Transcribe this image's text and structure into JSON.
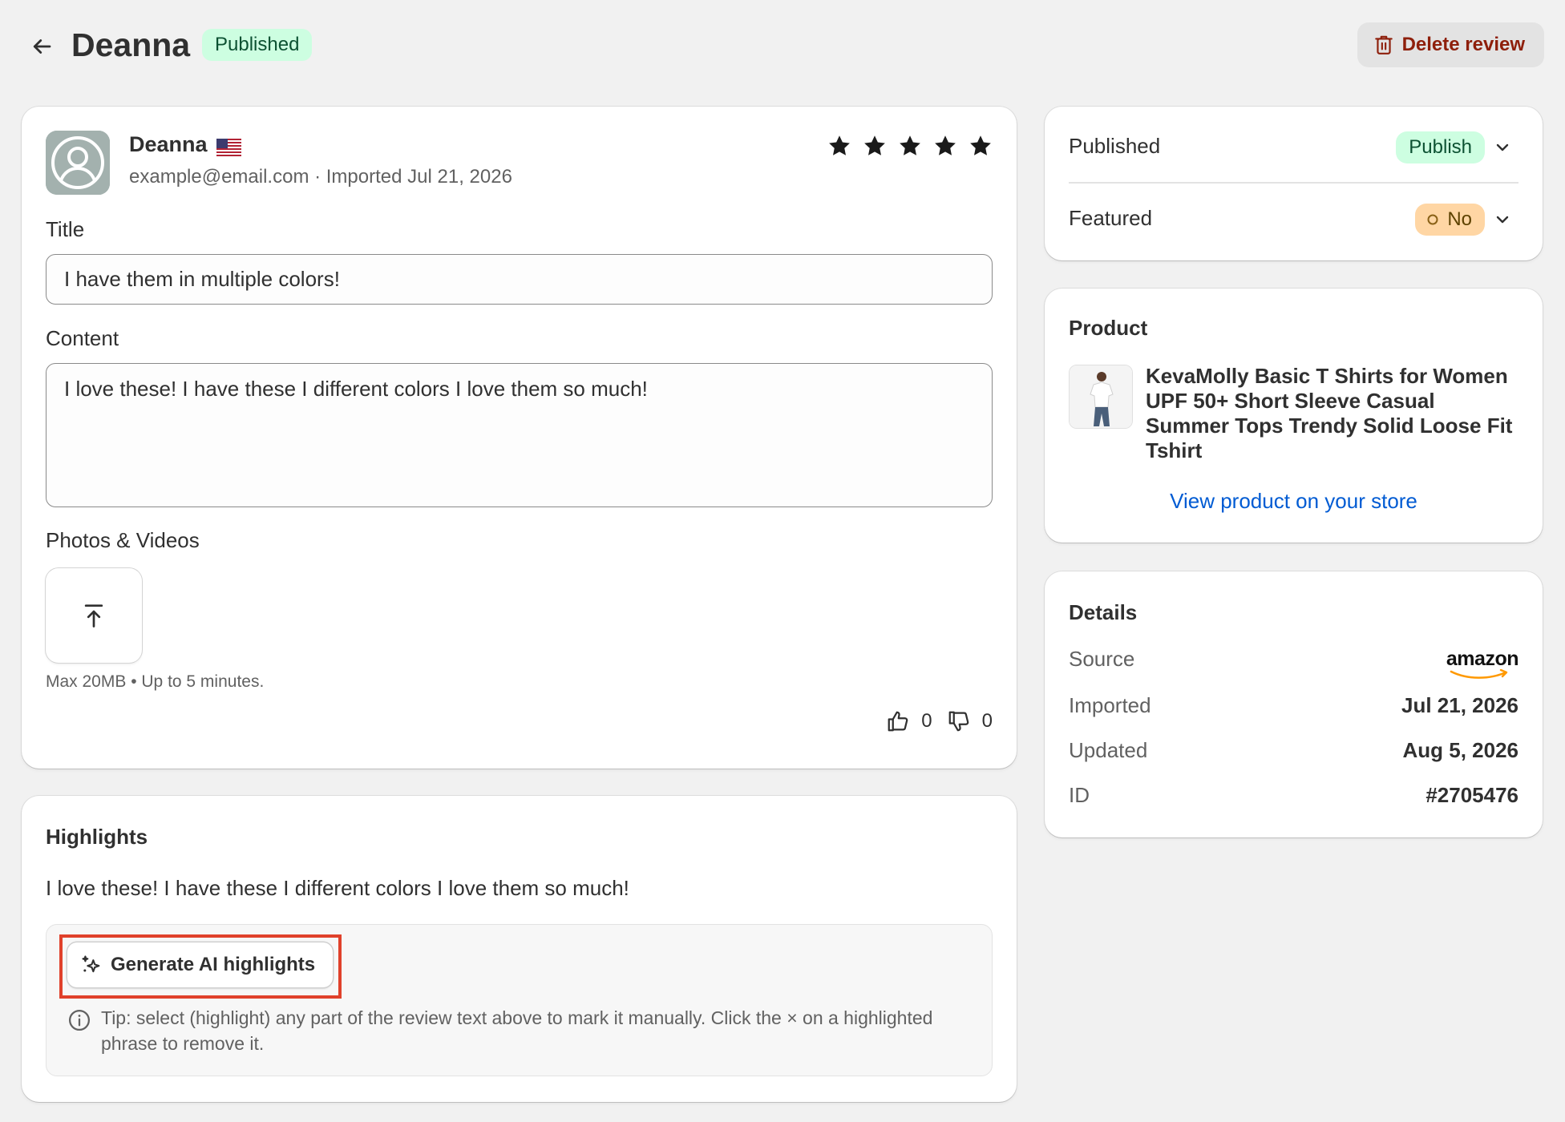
{
  "header": {
    "title": "Deanna",
    "status_badge": "Published",
    "delete_label": "Delete review"
  },
  "review": {
    "reviewer_name": "Deanna",
    "reviewer_meta": "example@email.com · Imported Jul 21, 2026",
    "rating": 5,
    "title_label": "Title",
    "title_value": "I have them in multiple colors!",
    "content_label": "Content",
    "content_value": "I love these! I have these I different colors I love them so much!",
    "media_label": "Photos & Videos",
    "media_hint": "Max 20MB • Up to 5 minutes.",
    "upvotes": "0",
    "downvotes": "0"
  },
  "highlights": {
    "heading": "Highlights",
    "text": "I love these! I have these I different colors I love them so much!",
    "ai_button": "Generate AI highlights",
    "tip": "Tip: select (highlight) any part of the review text above to mark it manually. Click the × on a highlighted phrase to remove it."
  },
  "status": {
    "published_label": "Published",
    "published_value": "Publish",
    "featured_label": "Featured",
    "featured_value": "No"
  },
  "product": {
    "heading": "Product",
    "name": "KevaMolly Basic T Shirts for Women UPF 50+ Short Sleeve Casual Summer Tops Trendy Solid Loose Fit Tshirt",
    "link": "View product on your store"
  },
  "details": {
    "heading": "Details",
    "source_label": "Source",
    "source_value": "amazon",
    "imported_label": "Imported",
    "imported_value": "Jul 21, 2026",
    "updated_label": "Updated",
    "updated_value": "Aug 5, 2026",
    "id_label": "ID",
    "id_value": "#2705476"
  },
  "colors": {
    "page_bg": "#f1f1f1",
    "success_bg": "#cdfee1",
    "success_text": "#0c5132",
    "warning_bg": "#ffd6a4",
    "critical_text": "#8e1f0b",
    "link": "#005bd3",
    "focus_outline": "#e0412b"
  },
  "icons": {
    "back": "arrow-left-icon",
    "delete": "trash-icon",
    "star": "star-icon",
    "upload": "upload-icon",
    "thumbs_up": "thumbs-up-icon",
    "thumbs_down": "thumbs-down-icon",
    "ai": "sparkle-icon",
    "info": "info-icon",
    "chevron": "chevron-down-icon"
  }
}
